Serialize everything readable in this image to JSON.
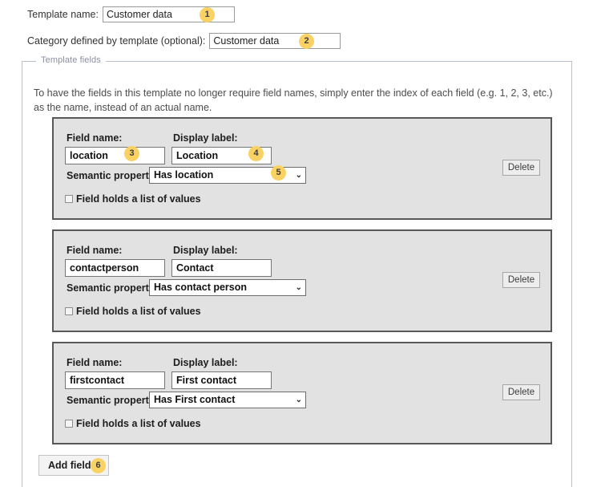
{
  "form": {
    "template_name": {
      "label": "Template name:",
      "value": "Customer data",
      "badge": "1"
    },
    "category": {
      "label": "Category defined by template (optional):",
      "value": "Customer data",
      "badge": "2"
    }
  },
  "fieldset": {
    "legend": "Template fields",
    "intro": "To have the fields in this template no longer require field names, simply enter the index of each field (e.g. 1, 2, 3, etc.) as the name, instead of an actual name.",
    "labels": {
      "field_name": "Field name:",
      "display_label": "Display label:",
      "semantic_property": "Semantic property:",
      "list_of_values": "Field holds a list of values",
      "delete": "Delete"
    },
    "select_arrow": "⌄",
    "fields": [
      {
        "name_value": "location",
        "name_badge": "3",
        "display_value": "Location",
        "display_badge": "4",
        "semantic_value": "Has location",
        "semantic_badge": "5",
        "list_checked": false
      },
      {
        "name_value": "contactperson",
        "name_badge": "",
        "display_value": "Contact",
        "display_badge": "",
        "semantic_value": "Has contact person",
        "semantic_badge": "",
        "list_checked": false
      },
      {
        "name_value": "firstcontact",
        "name_badge": "",
        "display_value": "First contact",
        "display_badge": "",
        "semantic_value": "Has First contact",
        "semantic_badge": "",
        "list_checked": false
      }
    ]
  },
  "add_field": {
    "label": "Add field",
    "badge": "6"
  },
  "colors": {
    "badge": "#F9D263",
    "group_bg": "#E2E2E2",
    "group_border": "#56585A",
    "fieldset_border": "#B9BED4"
  }
}
